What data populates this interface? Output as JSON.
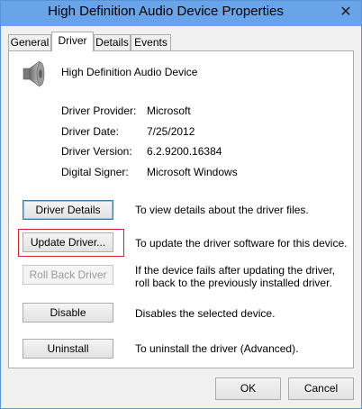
{
  "window": {
    "title": "High Definition Audio Device Properties",
    "close_glyph": "✕"
  },
  "tabs": [
    {
      "label": "General"
    },
    {
      "label": "Driver",
      "active": true
    },
    {
      "label": "Details"
    },
    {
      "label": "Events"
    }
  ],
  "device": {
    "icon": "speaker-icon",
    "name": "High Definition Audio Device"
  },
  "properties": [
    {
      "label": "Driver Provider:",
      "value": "Microsoft"
    },
    {
      "label": "Driver Date:",
      "value": "7/25/2012"
    },
    {
      "label": "Driver Version:",
      "value": "6.2.9200.16384"
    },
    {
      "label": "Digital Signer:",
      "value": "Microsoft Windows"
    }
  ],
  "actions": [
    {
      "button": "Driver Details",
      "description": "To view details about the driver files."
    },
    {
      "button": "Update Driver...",
      "description": "To update the driver software for this device."
    },
    {
      "button": "Roll Back Driver",
      "description": "If the device fails after updating the driver, roll back to the previously installed driver.",
      "disabled": true
    },
    {
      "button": "Disable",
      "description": "Disables the selected device."
    },
    {
      "button": "Uninstall",
      "description": "To uninstall the driver (Advanced)."
    }
  ],
  "footer": {
    "ok_label": "OK",
    "cancel_label": "Cancel"
  },
  "colors": {
    "titlebar": "#6aa4e8",
    "highlight_box": "#d6222a"
  }
}
